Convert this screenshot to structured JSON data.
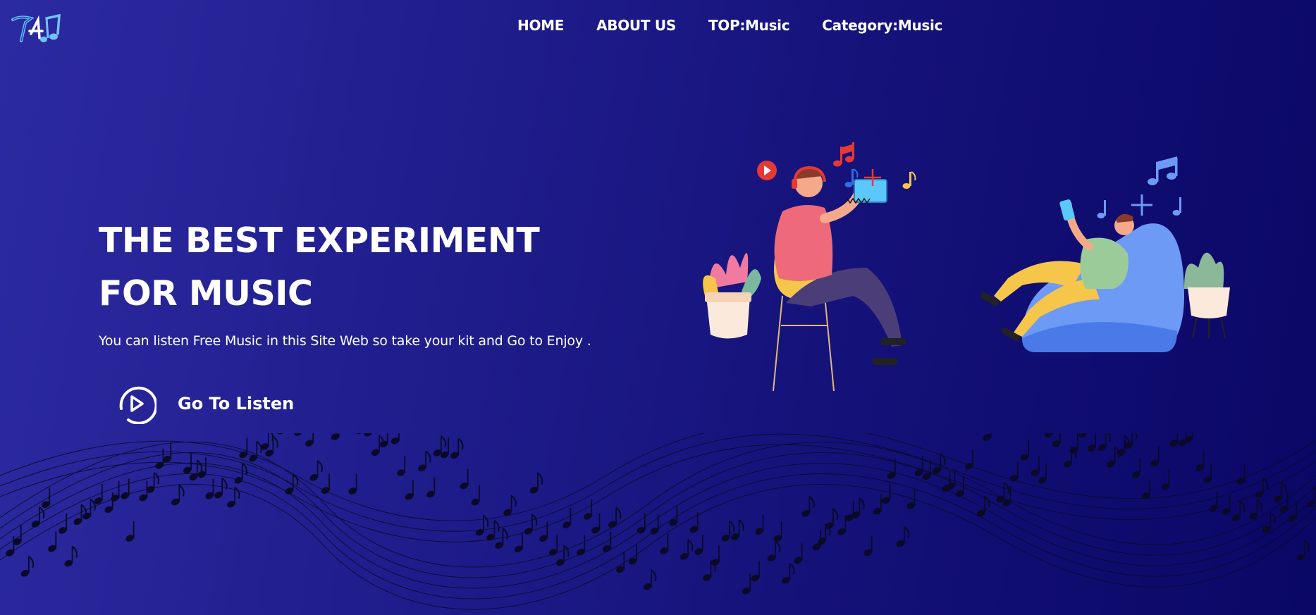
{
  "header": {
    "logo_icon": "music-note-logo-icon",
    "nav": [
      {
        "label": "HOME"
      },
      {
        "label": "ABOUT US"
      },
      {
        "label": "TOP:Music"
      },
      {
        "label": "Category:Music"
      }
    ]
  },
  "hero": {
    "title": "THE BEST EXPERIMENT FOR MUSIC",
    "subtitle": "You can listen Free Music in this Site Web so take your kit and Go to Enjoy .",
    "cta_label": "Go To Listen",
    "cta_icon": "play-circle-icon"
  },
  "colors": {
    "bg_start": "#2c2aa0",
    "bg_end": "#0a0766",
    "text": "#ffffff",
    "accent_blue": "#5c8cf0"
  }
}
